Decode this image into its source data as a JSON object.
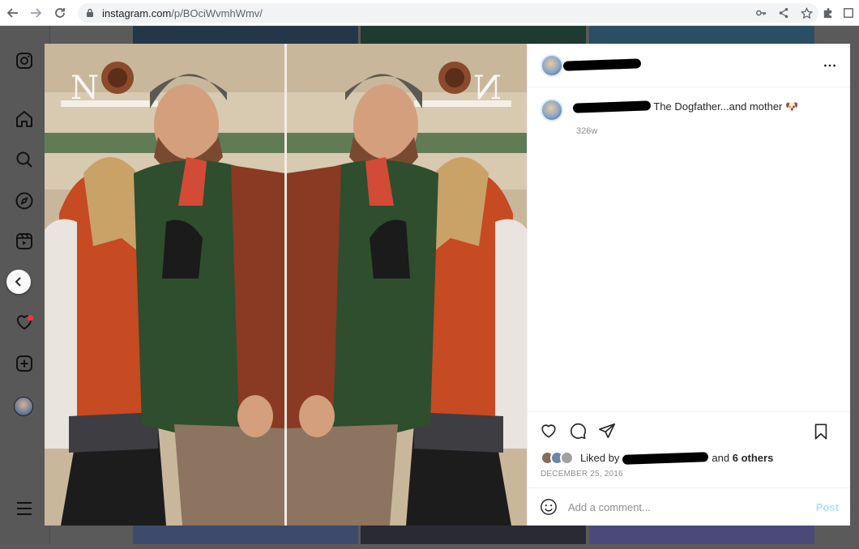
{
  "browser": {
    "url_host": "instagram.com",
    "url_path": "/p/BOciWvmhWmv/"
  },
  "post": {
    "caption": "The Dogfather...and mother 🐶",
    "age": "326w",
    "liked_by_prefix": "Liked by",
    "liked_and": "and",
    "liked_others": "6 others",
    "date": "DECEMBER 25, 2016",
    "comment_placeholder": "Add a comment...",
    "post_label": "Post"
  },
  "icons": {
    "rail": [
      "instagram-icon",
      "home-icon",
      "search-icon",
      "explore-icon",
      "reels-icon",
      "heart-icon",
      "create-icon",
      "profile-avatar",
      "menu-icon"
    ],
    "actions": [
      "like-icon",
      "comment-icon",
      "share-icon",
      "save-icon"
    ]
  },
  "colors": {
    "notification_dot": "#ff3040",
    "post_button_disabled": "#b2dffc",
    "muted_text": "#8e8e8e"
  }
}
